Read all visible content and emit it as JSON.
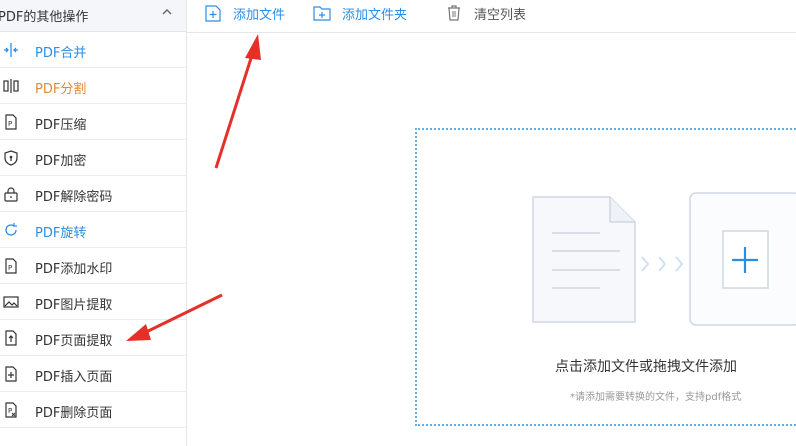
{
  "sidebar": {
    "header": "PDF的其他操作",
    "items": [
      {
        "label": "PDF合并",
        "icon": "merge-icon",
        "color": "blue"
      },
      {
        "label": "PDF分割",
        "icon": "split-icon",
        "color": "orange"
      },
      {
        "label": "PDF压缩",
        "icon": "compress-icon",
        "color": "default"
      },
      {
        "label": "PDF加密",
        "icon": "shield-icon",
        "color": "default"
      },
      {
        "label": "PDF解除密码",
        "icon": "unlock-icon",
        "color": "default"
      },
      {
        "label": "PDF旋转",
        "icon": "rotate-icon",
        "color": "blue"
      },
      {
        "label": "PDF添加水印",
        "icon": "watermark-icon",
        "color": "default"
      },
      {
        "label": "PDF图片提取",
        "icon": "image-icon",
        "color": "default"
      },
      {
        "label": "PDF页面提取",
        "icon": "page-extract-icon",
        "color": "default"
      },
      {
        "label": "PDF插入页面",
        "icon": "page-insert-icon",
        "color": "default"
      },
      {
        "label": "PDF删除页面",
        "icon": "page-delete-icon",
        "color": "default"
      }
    ]
  },
  "toolbar": {
    "add_file": "添加文件",
    "add_folder": "添加文件夹",
    "clear_list": "清空列表"
  },
  "dropzone": {
    "main_text": "点击添加文件或拖拽文件添加",
    "sub_text": "*请添加需要转换的文件，支持pdf格式"
  },
  "colors": {
    "accent": "#2a8ee6",
    "orange": "#e08a32",
    "annotation": "#e5302a"
  }
}
